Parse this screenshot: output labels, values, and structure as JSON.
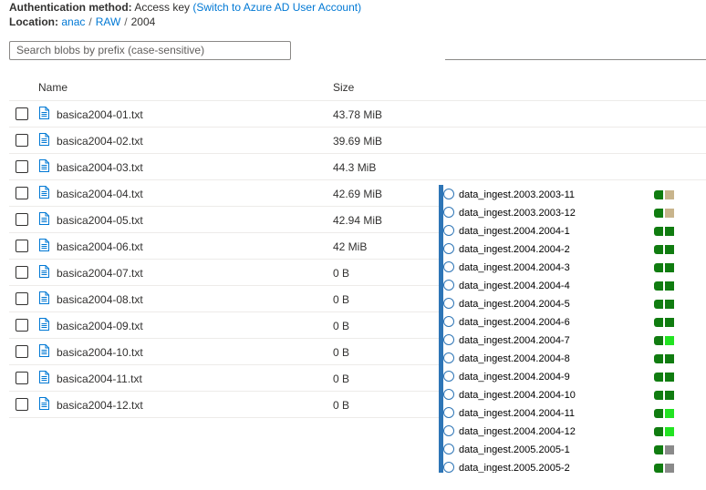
{
  "auth": {
    "label": "Authentication method:",
    "value": "Access key",
    "switch_link": "(Switch to Azure AD User Account)"
  },
  "location": {
    "label": "Location:",
    "crumbs": [
      "anac",
      "RAW",
      "2004"
    ],
    "separator": "/"
  },
  "search": {
    "placeholder": "Search blobs by prefix (case-sensitive)"
  },
  "columns": {
    "name": "Name",
    "size": "Size"
  },
  "rows": [
    {
      "name": "basica2004-01.txt",
      "size": "43.78 MiB"
    },
    {
      "name": "basica2004-02.txt",
      "size": "39.69 MiB"
    },
    {
      "name": "basica2004-03.txt",
      "size": "44.3 MiB"
    },
    {
      "name": "basica2004-04.txt",
      "size": "42.69 MiB"
    },
    {
      "name": "basica2004-05.txt",
      "size": "42.94 MiB"
    },
    {
      "name": "basica2004-06.txt",
      "size": "42 MiB"
    },
    {
      "name": "basica2004-07.txt",
      "size": "0 B"
    },
    {
      "name": "basica2004-08.txt",
      "size": "0 B"
    },
    {
      "name": "basica2004-09.txt",
      "size": "0 B"
    },
    {
      "name": "basica2004-10.txt",
      "size": "0 B"
    },
    {
      "name": "basica2004-11.txt",
      "size": "0 B"
    },
    {
      "name": "basica2004-12.txt",
      "size": "0 B"
    }
  ],
  "colors": {
    "accent": "#0078d4",
    "panel_bar": "#2e75b6",
    "status_dark_green": "#107c10",
    "status_light_green": "#22e322",
    "status_tan": "#c8b48c",
    "status_gray": "#8a8a8a"
  },
  "pipeline_runs": [
    {
      "label": "data_ingest.2003.2003-11",
      "status2": "#c8b48c"
    },
    {
      "label": "data_ingest.2003.2003-12",
      "status2": "#c8b48c"
    },
    {
      "label": "data_ingest.2004.2004-1",
      "status2": "#107c10"
    },
    {
      "label": "data_ingest.2004.2004-2",
      "status2": "#107c10"
    },
    {
      "label": "data_ingest.2004.2004-3",
      "status2": "#107c10"
    },
    {
      "label": "data_ingest.2004.2004-4",
      "status2": "#107c10"
    },
    {
      "label": "data_ingest.2004.2004-5",
      "status2": "#107c10"
    },
    {
      "label": "data_ingest.2004.2004-6",
      "status2": "#107c10"
    },
    {
      "label": "data_ingest.2004.2004-7",
      "status2": "#22e322"
    },
    {
      "label": "data_ingest.2004.2004-8",
      "status2": "#107c10"
    },
    {
      "label": "data_ingest.2004.2004-9",
      "status2": "#107c10"
    },
    {
      "label": "data_ingest.2004.2004-10",
      "status2": "#107c10"
    },
    {
      "label": "data_ingest.2004.2004-11",
      "status2": "#22e322"
    },
    {
      "label": "data_ingest.2004.2004-12",
      "status2": "#22e322"
    },
    {
      "label": "data_ingest.2005.2005-1",
      "status2": "#8a8a8a"
    },
    {
      "label": "data_ingest.2005.2005-2",
      "status2": "#8a8a8a"
    }
  ]
}
